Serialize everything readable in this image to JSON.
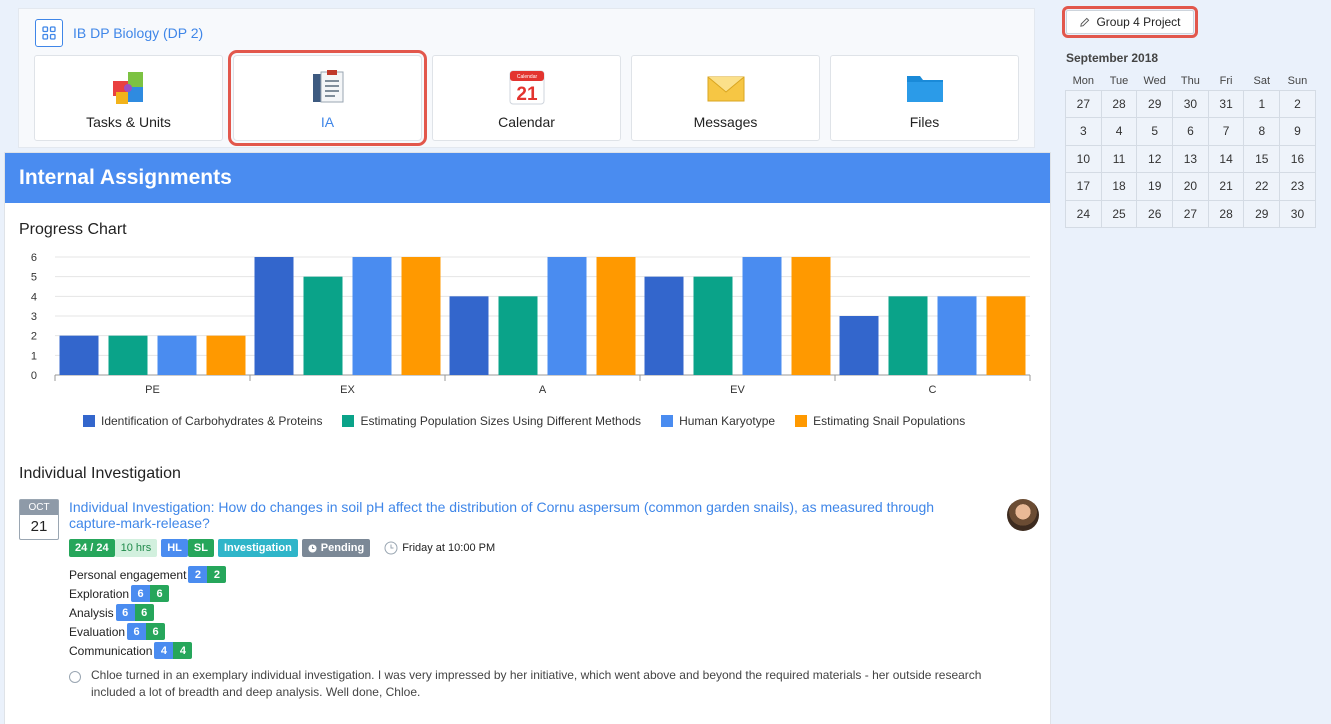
{
  "course": {
    "title": "IB DP Biology (DP 2)"
  },
  "tiles": [
    {
      "label": "Tasks & Units",
      "icon": "puzzle-icon"
    },
    {
      "label": "IA",
      "icon": "clipboard-icon"
    },
    {
      "label": "Calendar",
      "icon": "calendar-icon",
      "day": "21",
      "banner": "Calendar"
    },
    {
      "label": "Messages",
      "icon": "envelope-icon"
    },
    {
      "label": "Files",
      "icon": "folder-icon"
    }
  ],
  "main": {
    "header": "Internal Assignments",
    "progress_title": "Progress Chart",
    "investigation_section_title": "Individual Investigation"
  },
  "chart_data": {
    "type": "bar",
    "categories": [
      "PE",
      "EX",
      "A",
      "EV",
      "C"
    ],
    "series": [
      {
        "name": "Identification of Carbohydrates & Proteins",
        "values": [
          2,
          6,
          4,
          5,
          3
        ],
        "color": "#3366cc"
      },
      {
        "name": "Estimating Population Sizes Using Different Methods",
        "values": [
          2,
          5,
          4,
          5,
          4
        ],
        "color": "#0aa389"
      },
      {
        "name": "Human Karyotype",
        "values": [
          2,
          6,
          6,
          6,
          4
        ],
        "color": "#4a8cf0"
      },
      {
        "name": "Estimating Snail Populations",
        "values": [
          2,
          6,
          6,
          6,
          4
        ],
        "color": "#ff9900"
      }
    ],
    "ylim": [
      0,
      6
    ],
    "yticks": [
      "0",
      "1",
      "2",
      "3",
      "4",
      "5",
      "6"
    ],
    "grid": true,
    "legend": "bottom"
  },
  "investigation": {
    "month": "OCT",
    "day": "21",
    "title": "Individual Investigation: How do changes in soil pH affect the distribution of Cornu aspersum (common garden snails), as measured through capture-mark-release?",
    "score": "24 / 24",
    "hours": "10 hrs",
    "level_hl": "HL",
    "level_sl": "SL",
    "type": "Investigation",
    "status": "Pending",
    "due": "Friday at 10:00 PM",
    "criteria": [
      {
        "label": "Personal engagement",
        "a": "2",
        "b": "2"
      },
      {
        "label": "Exploration",
        "a": "6",
        "b": "6"
      },
      {
        "label": "Analysis",
        "a": "6",
        "b": "6"
      },
      {
        "label": "Evaluation",
        "a": "6",
        "b": "6"
      },
      {
        "label": "Communication",
        "a": "4",
        "b": "4"
      }
    ],
    "comment": "Chloe turned in an exemplary individual investigation. I was very impressed by her initiative, which went above and beyond the required materials - her outside research included a lot of breadth and deep analysis. Well done, Chloe."
  },
  "sidebar": {
    "project_button": "Group 4 Project",
    "calendar_title": "September 2018",
    "weekdays": [
      "Mon",
      "Tue",
      "Wed",
      "Thu",
      "Fri",
      "Sat",
      "Sun"
    ],
    "weeks": [
      [
        "27",
        "28",
        "29",
        "30",
        "31",
        "1",
        "2"
      ],
      [
        "3",
        "4",
        "5",
        "6",
        "7",
        "8",
        "9"
      ],
      [
        "10",
        "11",
        "12",
        "13",
        "14",
        "15",
        "16"
      ],
      [
        "17",
        "18",
        "19",
        "20",
        "21",
        "22",
        "23"
      ],
      [
        "24",
        "25",
        "26",
        "27",
        "28",
        "29",
        "30"
      ]
    ]
  }
}
